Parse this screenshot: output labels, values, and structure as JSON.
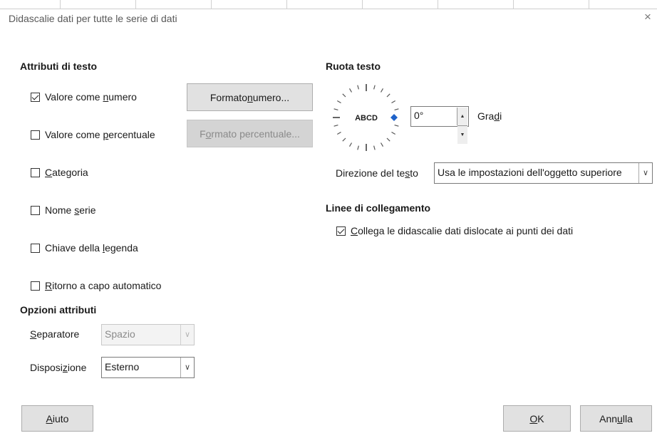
{
  "dialog": {
    "title": "Didascalie dati per tutte le serie di dati",
    "close_glyph": "×"
  },
  "text_attributes": {
    "heading": "Attributi di testo",
    "checkboxes": [
      {
        "pre": "Valore come ",
        "mn": "n",
        "post": "umero",
        "checked": true
      },
      {
        "pre": "Valore come ",
        "mn": "p",
        "post": "ercentuale",
        "checked": false
      },
      {
        "pre": "",
        "mn": "C",
        "post": "ategoria",
        "checked": false
      },
      {
        "pre": "Nome ",
        "mn": "s",
        "post": "erie",
        "checked": false
      },
      {
        "pre": "Chiave della ",
        "mn": "l",
        "post": "egenda",
        "checked": false
      },
      {
        "pre": "",
        "mn": "R",
        "post": "itorno a capo automatico",
        "checked": false
      }
    ],
    "number_format_button": {
      "pre": "Formato ",
      "mn": "n",
      "post": "umero..."
    },
    "percent_format_button": {
      "pre": "F",
      "mn": "o",
      "post": "rmato percentuale...",
      "enabled": false
    }
  },
  "attribute_options": {
    "heading": "Opzioni attributi",
    "separator": {
      "pre": "",
      "mn": "S",
      "post": "eparatore",
      "value": "Spazio",
      "enabled": false
    },
    "placement": {
      "pre": "Disposi",
      "mn": "z",
      "post": "ione",
      "value": "Esterno",
      "enabled": true
    }
  },
  "rotate_text": {
    "heading": "Ruota testo",
    "dial_text": "ABCD",
    "degrees_value": "0°",
    "degrees_label": {
      "pre": "Gra",
      "mn": "d",
      "post": "i"
    },
    "direction_label": {
      "pre": "Direzione del te",
      "mn": "s",
      "post": "to"
    },
    "direction_value": "Usa le impostazioni dell'oggetto superiore"
  },
  "leader_lines": {
    "heading": "Linee di collegamento",
    "checkbox": {
      "pre": "",
      "mn": "C",
      "post": "ollega le didascalie dati dislocate ai punti dei dati",
      "checked": true
    }
  },
  "buttons": {
    "help": {
      "pre": "",
      "mn": "A",
      "post": "iuto"
    },
    "ok": {
      "pre": "",
      "mn": "O",
      "post": "K"
    },
    "cancel": {
      "pre": "Ann",
      "mn": "u",
      "post": "lla"
    }
  },
  "colors": {
    "dial_marker": "#1f62c9",
    "button_face": "#e1e1e1"
  }
}
